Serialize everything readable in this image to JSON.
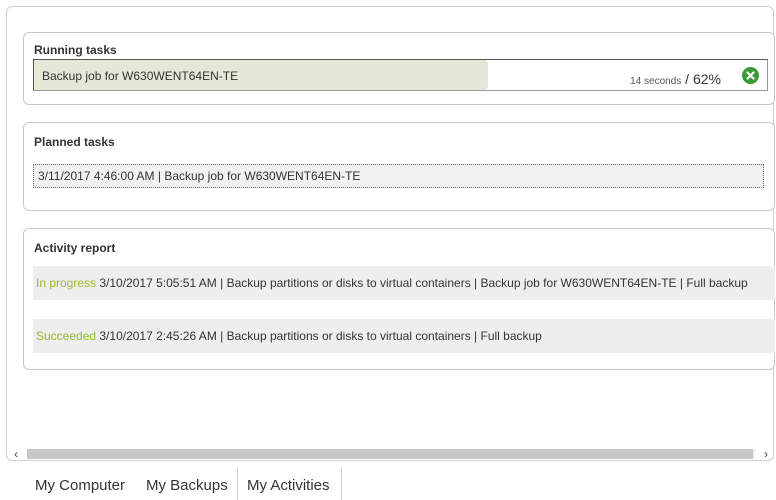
{
  "running": {
    "title": "Running tasks",
    "job_label": "Backup job for W630WENT64EN-TE",
    "elapsed": "14 seconds",
    "separator": " / ",
    "percent_text": "62%",
    "progress": 0.62
  },
  "planned": {
    "title": "Planned tasks",
    "items": [
      "3/11/2017 4:46:00 AM | Backup job for W630WENT64EN-TE"
    ]
  },
  "activity": {
    "title": "Activity report",
    "rows": [
      {
        "status": "In progress",
        "detail": " 3/10/2017 5:05:51 AM | Backup partitions or disks to virtual containers | Backup job for W630WENT64EN-TE | Full backup"
      },
      {
        "status": "Succeeded",
        "detail": " 3/10/2017 2:45:26 AM | Backup partitions or disks to virtual containers | Full backup"
      }
    ]
  },
  "scrollbar": {
    "left_arrow": "‹",
    "right_arrow": "›"
  },
  "tabs": [
    {
      "label": "My Computer",
      "active": false
    },
    {
      "label": "My Backups",
      "active": false
    },
    {
      "label": "My Activities",
      "active": true
    }
  ],
  "colors": {
    "accent_status": "#99bb33",
    "progress_fill": "#e5e8d6",
    "cancel_button": "#3a9a3a"
  },
  "icons": {
    "cancel": "close-circle-icon"
  }
}
